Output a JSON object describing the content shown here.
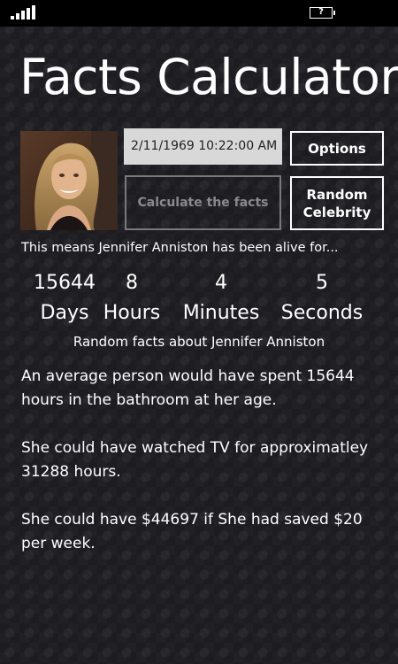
{
  "status_bar": {
    "signal_icon": "signal-strength-icon",
    "battery_icon": "battery-icon",
    "battery_label": "?"
  },
  "app": {
    "title": "Facts Calculator"
  },
  "controls": {
    "birth_datetime": "2/11/1969 10:22:00 AM",
    "options_label": "Options",
    "calculate_label": "Calculate the facts",
    "random_label_line1": "Random",
    "random_label_line2": "Celebrity"
  },
  "summary": {
    "alive_text": "This means Jennifer Anniston has been alive for..."
  },
  "counters": {
    "days": {
      "value": "15644",
      "unit": "Days"
    },
    "hours": {
      "value": "8",
      "unit": "Hours"
    },
    "minutes": {
      "value": "4",
      "unit": "Minutes"
    },
    "seconds": {
      "value": "5",
      "unit": "Seconds"
    }
  },
  "facts": {
    "heading": "Random facts about Jennifer Anniston",
    "items": [
      "An average person would have spent 15644 hours in the bathroom at her age.",
      "She could have watched TV for approximatley 31288 hours.",
      "She could have $44697 if She had saved $20 per week."
    ]
  },
  "colors": {
    "background": "#1c1c21",
    "status_bar": "#000000",
    "text": "#ffffff",
    "date_field_bg": "#d8d8d8",
    "disabled_button": "#8a8a8a"
  }
}
